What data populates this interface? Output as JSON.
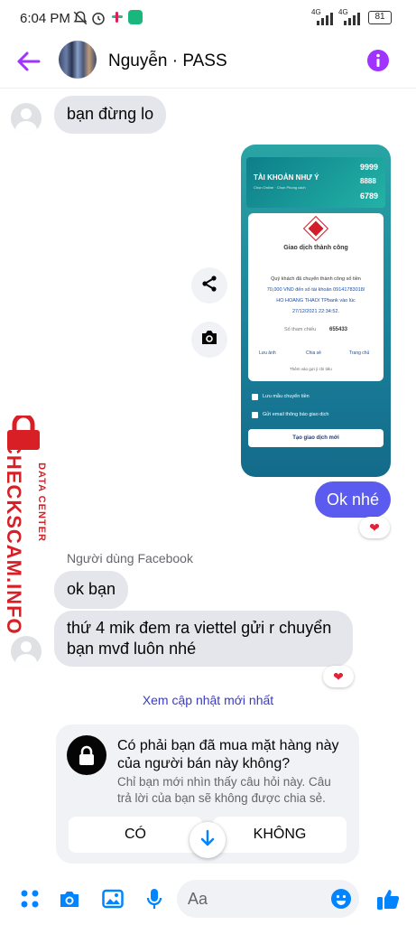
{
  "status_bar": {
    "time": "6:04 PM",
    "battery": "81",
    "net1": "4G",
    "net2": "4G"
  },
  "header": {
    "name": "Nguyễn · PASS"
  },
  "messages": {
    "m1": "bạn đừng lo",
    "m2": "Ok nhé",
    "sender_label": "Người dùng Facebook",
    "m3": "ok bạn",
    "m4_line1": "thứ 4 mik đem ra viettel gửi r chuyển",
    "m4_line2": "bạn mvđ luôn nhé",
    "update_link": "Xem cập nhật mới nhất"
  },
  "receipt": {
    "banner_title": "TÀI KHOẢN NHƯ Ý",
    "banner_sub": "Chọn Online · Chọn Phong cách",
    "numbers": [
      "9999",
      "8888",
      "6789"
    ],
    "status": "Giao dịch thành công",
    "desc_1": "Quý khách đã chuyển thành công số tiền",
    "desc_2": "70,000 VND đến số tài khoản 09141783018/",
    "desc_3": "HO HOANG THAO/ TPbank vào lúc",
    "desc_4": "27/12/2021 22:34:52.",
    "ref_label": "Số tham chiếu",
    "ref_value": "655433",
    "actions": [
      "Lưu ảnh",
      "Chia sẻ",
      "Trang chủ"
    ],
    "note": "Thêm vào gợi ý chi tiêu",
    "check1": "Lưu mẫu chuyển tiền",
    "check2": "Gửi email thông báo giao dịch",
    "new_button": "Tạo giao dịch mới"
  },
  "watermark": {
    "main": "CHECKSCAM.INFO",
    "sub": "DATA CENTER"
  },
  "prompt_card": {
    "question_1": "Có phải bạn đã mua mặt hàng này",
    "question_2": "của người bán này không?",
    "hint_1": "Chỉ bạn mới nhìn thấy câu hỏi này. Câu",
    "hint_2": "trả lời của bạn sẽ không được chia sẻ.",
    "yes": "CÓ",
    "no": "KHÔNG"
  },
  "composer": {
    "placeholder": "Aa"
  },
  "colors": {
    "accent": "#0084ff",
    "purple": "#a033ff",
    "bubble_out": "#5b5bf0",
    "watermark": "#d91f26"
  },
  "icons": [
    "back-arrow-icon",
    "info-icon",
    "share-icon",
    "camera-icon",
    "heart-icon",
    "lock-icon",
    "arrow-down-icon",
    "apps-icon",
    "camera-icon",
    "image-icon",
    "mic-icon",
    "emoji-icon",
    "thumbs-up-icon"
  ]
}
